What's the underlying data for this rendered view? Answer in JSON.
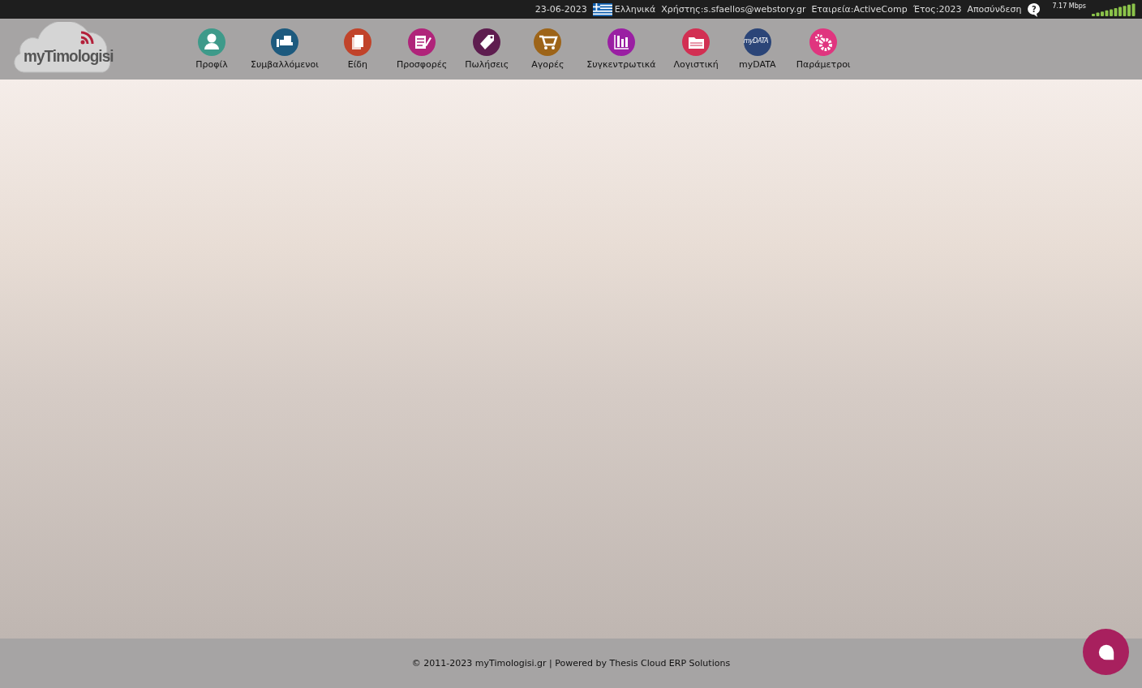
{
  "top_bar": {
    "date": "23-06-2023",
    "language": "Ελληνικά",
    "user": "Χρήστης:s.sfaellos@webstory.gr",
    "company": "Εταιρεία:ActiveComp",
    "year": "Έτος:2023",
    "logout": "Αποσύνδεση",
    "help": "?",
    "speed": "7.17 Mbps"
  },
  "logo": {
    "text": "myTimologisi"
  },
  "nav": [
    {
      "label": "Προφίλ",
      "kind": "user",
      "color": "#3e9a8a"
    },
    {
      "label": "Συμβαλλόμενοι",
      "kind": "hand",
      "color": "#1d5a7e"
    },
    {
      "label": "Είδη",
      "kind": "pages",
      "color": "#c1432a"
    },
    {
      "label": "Προσφορές",
      "kind": "notepad",
      "color": "#b0247a"
    },
    {
      "label": "Πωλήσεις",
      "kind": "tag",
      "color": "#5e1d4f"
    },
    {
      "label": "Αγορές",
      "kind": "cart",
      "color": "#9d6418"
    },
    {
      "label": "Συγκεντρωτικά",
      "kind": "chart",
      "color": "#9a1fa3"
    },
    {
      "label": "Λογιστική",
      "kind": "folder",
      "color": "#d22f52"
    },
    {
      "label": "myDATA",
      "kind": "text",
      "color": "#2b4578",
      "icon_text": "myDATA"
    },
    {
      "label": "Παράμετροι",
      "kind": "gears",
      "color": "#e0357f"
    }
  ],
  "footer": {
    "text": "© 2011-2023 myTimologisi.gr | Powered by Thesis Cloud ERP Solutions"
  }
}
